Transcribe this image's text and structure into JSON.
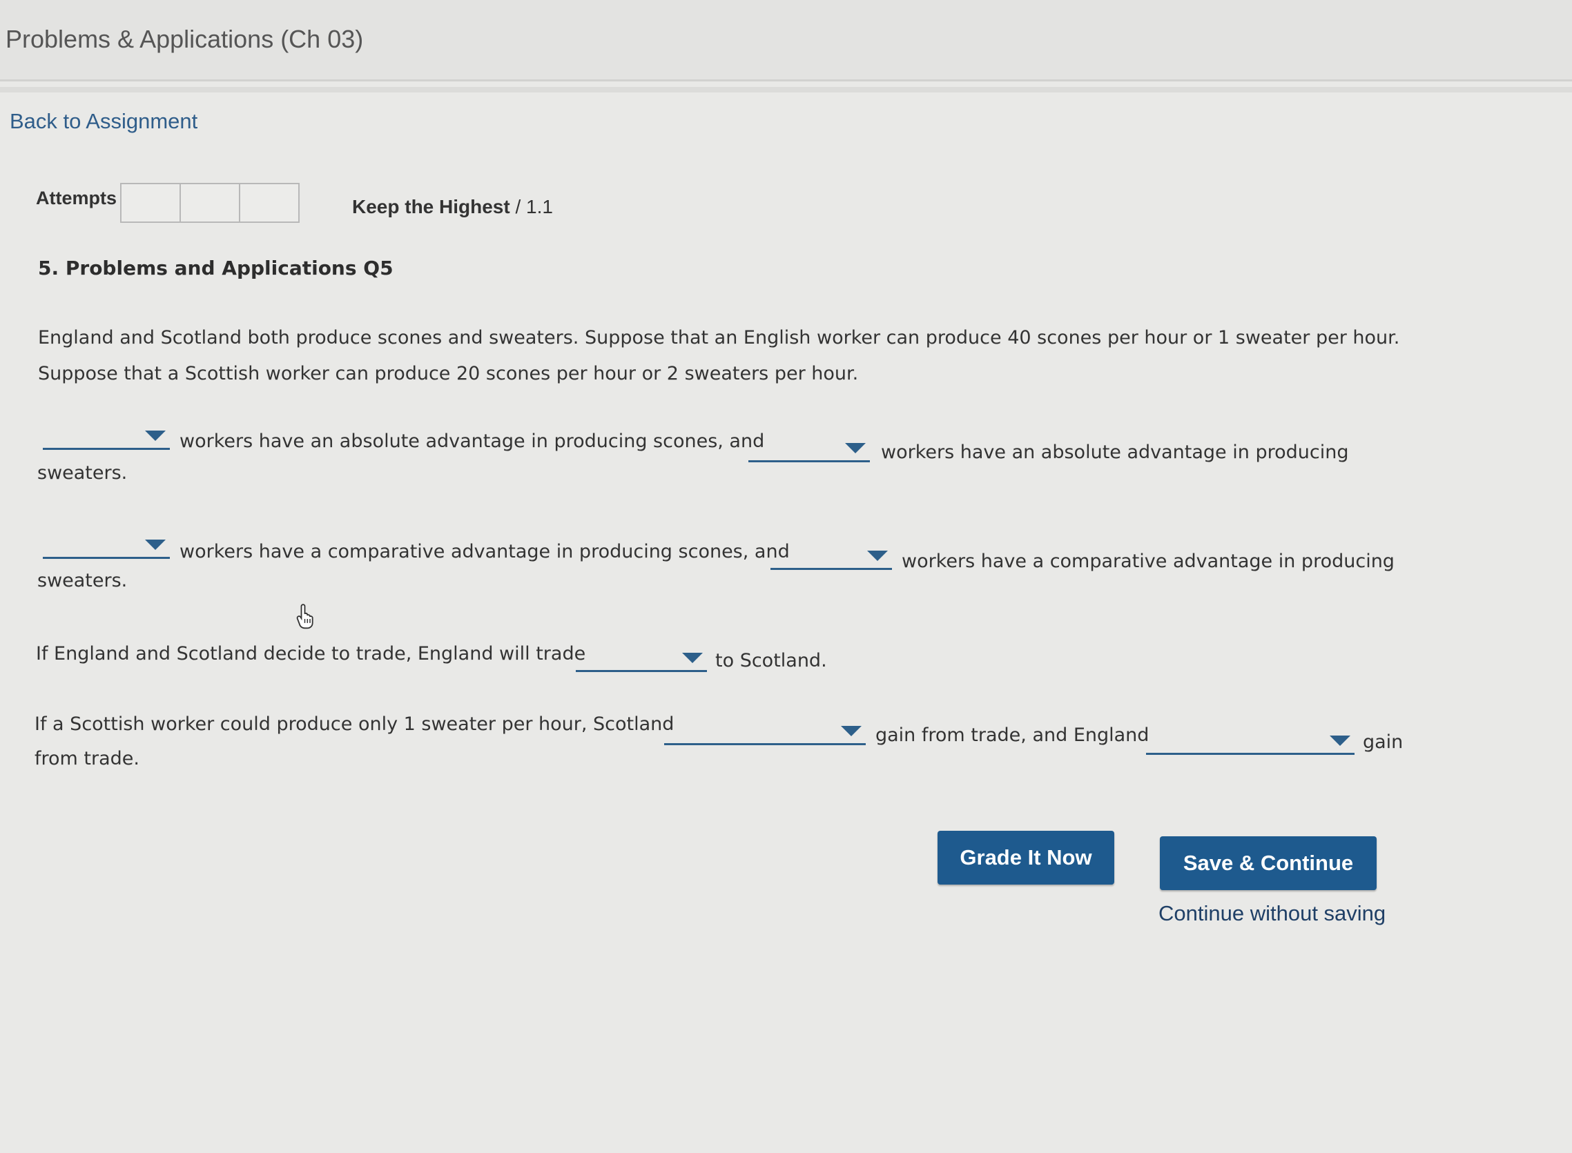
{
  "header": {
    "title": "Problems & Applications (Ch 03)"
  },
  "nav": {
    "back_link": "Back to Assignment"
  },
  "attempts": {
    "label": "Attempts",
    "keep_highest_bold": "Keep the Highest",
    "score_suffix": " / 1.1"
  },
  "question": {
    "heading": "5. Problems and Applications Q5",
    "intro_line1": "England and Scotland both produce scones and sweaters. Suppose that an English worker can produce 40 scones per hour or 1 sweater per hour.",
    "intro_line2": "Suppose that a Scottish worker can produce 20 scones per hour or 2 sweaters per hour.",
    "absolute": {
      "text_a": "workers have an absolute advantage in producing scones, and",
      "text_b": "workers have an absolute advantage in producing",
      "text_end": "sweaters."
    },
    "comparative": {
      "text_a": "workers have a comparative advantage in producing scones, and",
      "text_b": "workers have a comparative advantage in producing",
      "text_end": "sweaters."
    },
    "trade": {
      "text_a": "If England and Scotland decide to trade, England will trade",
      "text_b": "to Scotland."
    },
    "gain": {
      "text_a": "If a Scottish worker could produce only 1 sweater per hour, Scotland",
      "text_b": "gain from trade, and England",
      "text_c": "gain",
      "text_end": "from trade."
    }
  },
  "actions": {
    "grade_label": "Grade It Now",
    "save_label": "Save & Continue",
    "continue_label": "Continue without saving"
  },
  "colors": {
    "accent": "#1e5a8e",
    "link": "#2f5d8a"
  }
}
